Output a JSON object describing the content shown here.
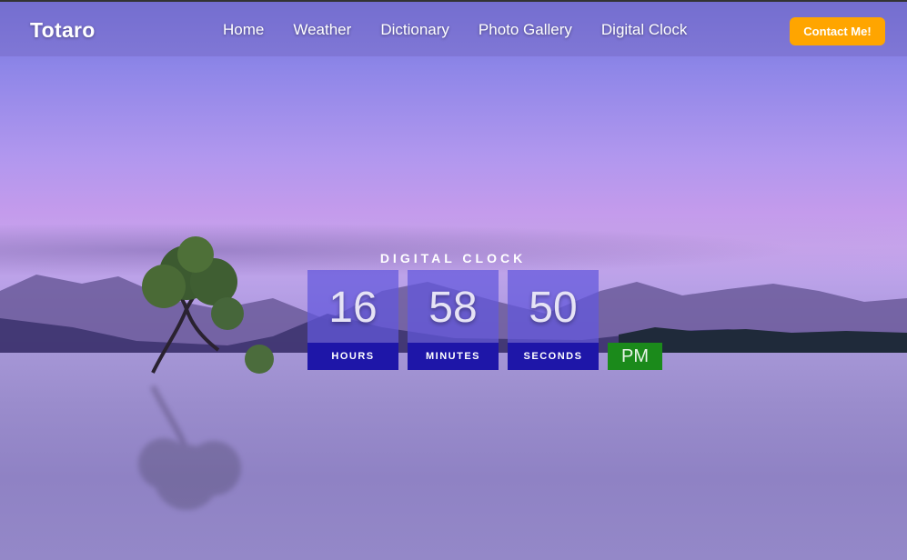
{
  "navbar": {
    "brand": "Totaro",
    "links": [
      "Home",
      "Weather",
      "Dictionary",
      "Photo Gallery",
      "Digital Clock"
    ],
    "contact_label": "Contact Me!",
    "contact_color": "#ffa500"
  },
  "clock": {
    "title": "DIGITAL CLOCK",
    "hours": "16",
    "minutes": "58",
    "seconds": "50",
    "hours_label": "HOURS",
    "minutes_label": "MINUTES",
    "seconds_label": "SECONDS",
    "period": "PM",
    "box_color": "#6258dc",
    "label_color": "#1e16a8",
    "period_color": "#1b8a1b"
  }
}
